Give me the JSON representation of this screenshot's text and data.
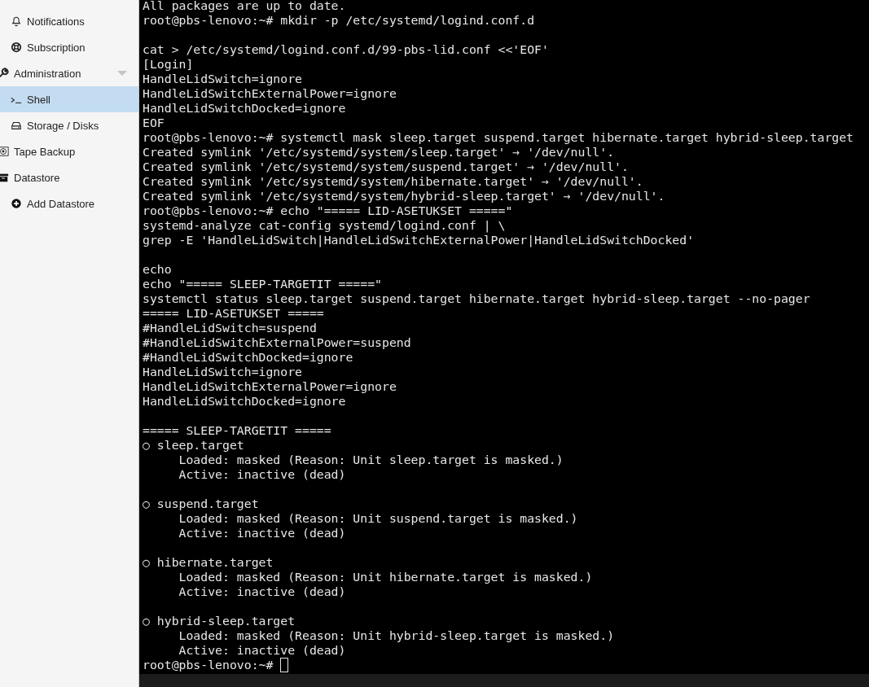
{
  "sidebar": {
    "items": [
      {
        "children": [
          {
            "label": "Notifications",
            "selected": false
          },
          {
            "label": "Subscription",
            "selected": false
          }
        ]
      },
      {
        "label": "Administration",
        "selected": false,
        "expanded": true,
        "children": [
          {
            "label": "Shell",
            "selected": true
          },
          {
            "label": "Storage / Disks",
            "selected": false
          }
        ]
      },
      {
        "label": "Tape Backup",
        "selected": false
      },
      {
        "label": "Datastore",
        "selected": false,
        "children": [
          {
            "label": "Add Datastore",
            "selected": false
          }
        ]
      }
    ]
  },
  "terminal": {
    "blocks": [
      [
        "All packages are up to date.",
        "root@pbs-lenovo:~# mkdir -p /etc/systemd/logind.conf.d"
      ],
      [
        "cat > /etc/systemd/logind.conf.d/99-pbs-lid.conf <<'EOF'",
        "[Login]",
        "HandleLidSwitch=ignore",
        "HandleLidSwitchExternalPower=ignore",
        "HandleLidSwitchDocked=ignore",
        "EOF",
        "root@pbs-lenovo:~# systemctl mask sleep.target suspend.target hibernate.target hybrid-sleep.target",
        "Created symlink '/etc/systemd/system/sleep.target' → '/dev/null'.",
        "Created symlink '/etc/systemd/system/suspend.target' → '/dev/null'.",
        "Created symlink '/etc/systemd/system/hibernate.target' → '/dev/null'.",
        "Created symlink '/etc/systemd/system/hybrid-sleep.target' → '/dev/null'.",
        "root@pbs-lenovo:~# echo \"===== LID-ASETUKSET =====\"",
        "systemd-analyze cat-config systemd/logind.conf | \\",
        "grep -E 'HandleLidSwitch|HandleLidSwitchExternalPower|HandleLidSwitchDocked'"
      ],
      [
        "echo",
        "echo \"===== SLEEP-TARGETIT =====\"",
        "systemctl status sleep.target suspend.target hibernate.target hybrid-sleep.target --no-pager",
        "===== LID-ASETUKSET =====",
        "#HandleLidSwitch=suspend",
        "#HandleLidSwitchExternalPower=suspend",
        "#HandleLidSwitchDocked=ignore",
        "HandleLidSwitch=ignore",
        "HandleLidSwitchExternalPower=ignore",
        "HandleLidSwitchDocked=ignore"
      ],
      [
        "===== SLEEP-TARGETIT =====",
        "○ sleep.target",
        "     Loaded: masked (Reason: Unit sleep.target is masked.)",
        "     Active: inactive (dead)"
      ],
      [
        "○ suspend.target",
        "     Loaded: masked (Reason: Unit suspend.target is masked.)",
        "     Active: inactive (dead)"
      ],
      [
        "○ hibernate.target",
        "     Loaded: masked (Reason: Unit hibernate.target is masked.)",
        "     Active: inactive (dead)"
      ],
      [
        "○ hybrid-sleep.target",
        "     Loaded: masked (Reason: Unit hybrid-sleep.target is masked.)",
        "     Active: inactive (dead)",
        "root@pbs-lenovo:~# "
      ]
    ],
    "cursor": true
  }
}
